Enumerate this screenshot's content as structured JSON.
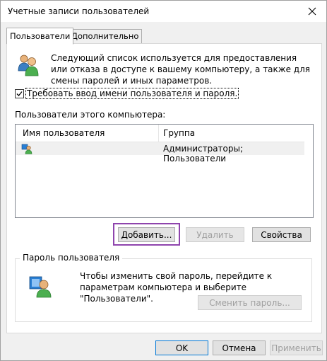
{
  "window": {
    "title": "Учетные записи пользователей"
  },
  "tabs": [
    {
      "label": "Пользователи",
      "active": true
    },
    {
      "label": "Дополнительно",
      "active": false
    }
  ],
  "intro": {
    "text": "Следующий список используется для предоставления или отказа в доступе к вашему компьютеру, а также для смены паролей и иных параметров."
  },
  "require_login": {
    "label": "Требовать ввод имени пользователя и пароля.",
    "checked": true
  },
  "users": {
    "label": "Пользователи этого компьютера:",
    "columns": [
      "Имя пользователя",
      "Группа"
    ],
    "rows": [
      {
        "name": "",
        "group": "Администраторы; Пользователи"
      }
    ]
  },
  "user_buttons": {
    "add": "Добавить...",
    "remove": "Удалить",
    "properties": "Свойства"
  },
  "password_group": {
    "title": "Пароль пользователя",
    "text": "Чтобы изменить свой пароль, перейдите к параметрам компьютера и выберите \"Пользователи\".",
    "change_button": "Сменить пароль..."
  },
  "footer_buttons": {
    "ok": "OK",
    "cancel": "Отмена",
    "apply": "Применить"
  },
  "colors": {
    "focus_outline": "#8e44ad",
    "default_button_border": "#0078d7"
  }
}
